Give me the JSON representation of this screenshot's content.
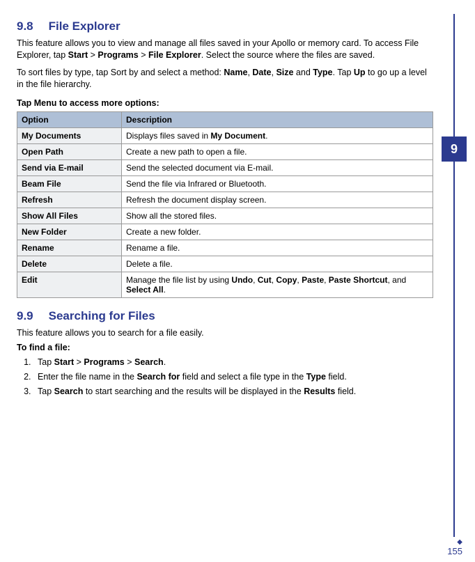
{
  "chapterTab": "9",
  "pageNumber": "155",
  "section98": {
    "num": "9.8",
    "title": "File Explorer",
    "intro_a": "This feature allows you to view and manage all files saved in your Apollo or memory card. To access File Explorer, tap ",
    "start": "Start",
    "gt": " > ",
    "programs": "Programs",
    "fileexp": "File Explorer",
    "intro_b": ". Select the source where the files are saved.",
    "sort_a": "To sort files by type, tap Sort by and select a method: ",
    "name": "Name",
    "comma": ", ",
    "date": "Date",
    "size": "Size",
    "and": " and ",
    "type": "Type",
    "sort_b": ". Tap ",
    "up": "Up",
    "sort_c": " to go up a level in the file hierarchy.",
    "tapmenu": "Tap Menu to access more options:",
    "th_option": "Option",
    "th_desc": "Description",
    "rows": [
      {
        "opt": "My Documents",
        "pre": "Displays files saved in ",
        "b1": "My Document",
        "post": "."
      },
      {
        "opt": "Open Path",
        "pre": "Create a new path to open a file."
      },
      {
        "opt": "Send via E-mail",
        "pre": "Send the selected document via E-mail."
      },
      {
        "opt": "Beam File",
        "pre": "Send the file via Infrared or Bluetooth."
      },
      {
        "opt": "Refresh",
        "pre": "Refresh the document display screen."
      },
      {
        "opt": "Show All Files",
        "pre": "Show all the stored files."
      },
      {
        "opt": "New Folder",
        "pre": "Create a new folder."
      },
      {
        "opt": "Rename",
        "pre": "Rename a file."
      },
      {
        "opt": "Delete",
        "pre": "Delete a file."
      },
      {
        "opt": "Edit",
        "pre": "Manage the file list by using ",
        "b1": "Undo",
        "c1": ", ",
        "b2": "Cut",
        "c2": ", ",
        "b3": "Copy",
        "c3": ", ",
        "b4": "Paste",
        "c4": ", ",
        "b5": "Paste Shortcut",
        "c5": ", and ",
        "b6": "Select All",
        "post": "."
      }
    ]
  },
  "section99": {
    "num": "9.9",
    "title": "Searching for Files",
    "intro": "This feature allows you to search for a file easily.",
    "tofind": "To find a file:",
    "step1_a": "Tap ",
    "start": "Start",
    "gt": " > ",
    "programs": "Programs",
    "search": "Search",
    "step1_b": ".",
    "step2_a": "Enter the file name in the ",
    "searchfor": "Search for",
    "step2_b": " field and select a file type in the ",
    "type": "Type",
    "step2_c": " field.",
    "step3_a": "Tap ",
    "step3_b": " to start searching and the results will be displayed in the ",
    "results": "Results",
    "step3_c": " field."
  }
}
